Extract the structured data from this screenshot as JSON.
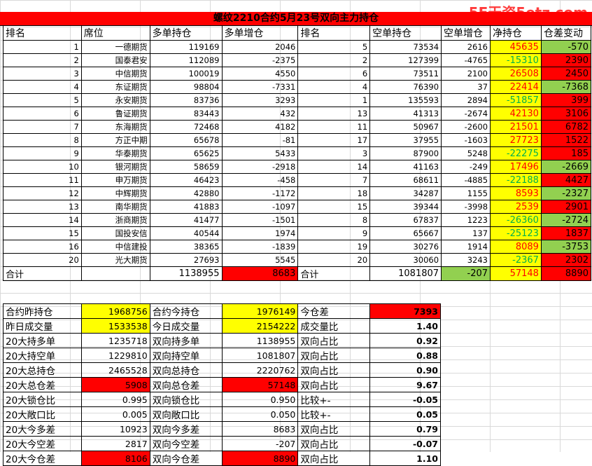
{
  "watermark": "5E天资5etz.com",
  "title": "螺纹2210合约5月23号双向主力持仓",
  "headers": [
    "排名",
    "席位",
    "多单持仓",
    "多单增仓",
    "排名",
    "空单持仓",
    "空单增仓",
    "净持仓",
    "仓差变动"
  ],
  "rows": [
    [
      "1",
      "一德期货",
      "119169",
      "2046",
      "5",
      "73534",
      "2616",
      "45635",
      "-570"
    ],
    [
      "2",
      "国泰君安",
      "112089",
      "-2375",
      "2",
      "127399",
      "-4765",
      "-15310",
      "2390"
    ],
    [
      "3",
      "中信期货",
      "100019",
      "4550",
      "6",
      "73511",
      "2100",
      "26508",
      "2450"
    ],
    [
      "4",
      "东证期货",
      "98804",
      "-7331",
      "4",
      "76390",
      "37",
      "22414",
      "-7368"
    ],
    [
      "5",
      "永安期货",
      "83736",
      "3293",
      "1",
      "135593",
      "2894",
      "-51857",
      "399"
    ],
    [
      "6",
      "鲁证期货",
      "83443",
      "432",
      "13",
      "41313",
      "-2674",
      "42130",
      "3106"
    ],
    [
      "7",
      "东海期货",
      "72468",
      "4182",
      "11",
      "50967",
      "-2600",
      "21501",
      "6782"
    ],
    [
      "8",
      "方正中期",
      "65678",
      "-81",
      "17",
      "37955",
      "-1603",
      "27723",
      "1522"
    ],
    [
      "9",
      "华泰期货",
      "65625",
      "5433",
      "3",
      "87900",
      "5248",
      "-22275",
      "185"
    ],
    [
      "10",
      "银河期货",
      "58659",
      "-2918",
      "14",
      "41163",
      "-249",
      "17496",
      "-2669"
    ],
    [
      "11",
      "申万期货",
      "46423",
      "-458",
      "7",
      "68611",
      "-4885",
      "-22188",
      "4427"
    ],
    [
      "12",
      "中辉期货",
      "42880",
      "-1172",
      "18",
      "34287",
      "1155",
      "8593",
      "-2327"
    ],
    [
      "13",
      "南华期货",
      "41883",
      "-1097",
      "15",
      "39344",
      "-3998",
      "2539",
      "2901"
    ],
    [
      "14",
      "浙商期货",
      "41477",
      "-1501",
      "8",
      "67837",
      "1223",
      "-26360",
      "-2724"
    ],
    [
      "15",
      "国投安信",
      "40544",
      "1974",
      "9",
      "65667",
      "137",
      "-25123",
      "1837"
    ],
    [
      "16",
      "中信建投",
      "38365",
      "-1839",
      "19",
      "30276",
      "1914",
      "8089",
      "-3753"
    ],
    [
      "20",
      "光大期货",
      "27693",
      "5545",
      "20",
      "30060",
      "3243",
      "-2367",
      "2302"
    ]
  ],
  "sum": {
    "label": "合计",
    "long": "1138955",
    "long_chg": "8683",
    "label2": "合计",
    "short": "1081807",
    "short_chg": "-207",
    "net": "57148",
    "diff": "8890"
  },
  "stats": [
    [
      "合约昨持仓",
      "1968756",
      "合约今持仓",
      "1976149",
      "今仓差",
      "7393"
    ],
    [
      "昨日成交量",
      "1533538",
      "今日成交量",
      "2154222",
      "成交量比",
      "1.40"
    ],
    [
      "20大持多单",
      "1235718",
      "双向持多单",
      "1138955",
      "双向占比",
      "0.92"
    ],
    [
      "20大持空单",
      "1229810",
      "双向持空单",
      "1081807",
      "双向占比",
      "0.88"
    ],
    [
      "20大总持仓",
      "2465528",
      "双向总持仓",
      "2220762",
      "双向占比",
      "0.90"
    ],
    [
      "20大总仓差",
      "5908",
      "双向总仓差",
      "57148",
      "双向占比",
      "9.67"
    ],
    [
      "20大锁仓比",
      "0.995",
      "双向锁仓比",
      "0.950",
      "比较+-",
      "-0.05"
    ],
    [
      "20大敞口比",
      "0.005",
      "双向敞口比",
      "0.050",
      "比较+-",
      "0.05"
    ],
    [
      "20大今多差",
      "10923",
      "双向今多差",
      "8683",
      "双向占比",
      "0.79"
    ],
    [
      "20大今空差",
      "2817",
      "双向今空差",
      "-207",
      "双向占比",
      "-0.07"
    ],
    [
      "20大今仓差",
      "8106",
      "双向今仓差",
      "8890",
      "双向占比",
      "1.10"
    ]
  ],
  "colors": {
    "yellow": "#ffff00",
    "green": "#92d050",
    "red": "#ff0000"
  }
}
